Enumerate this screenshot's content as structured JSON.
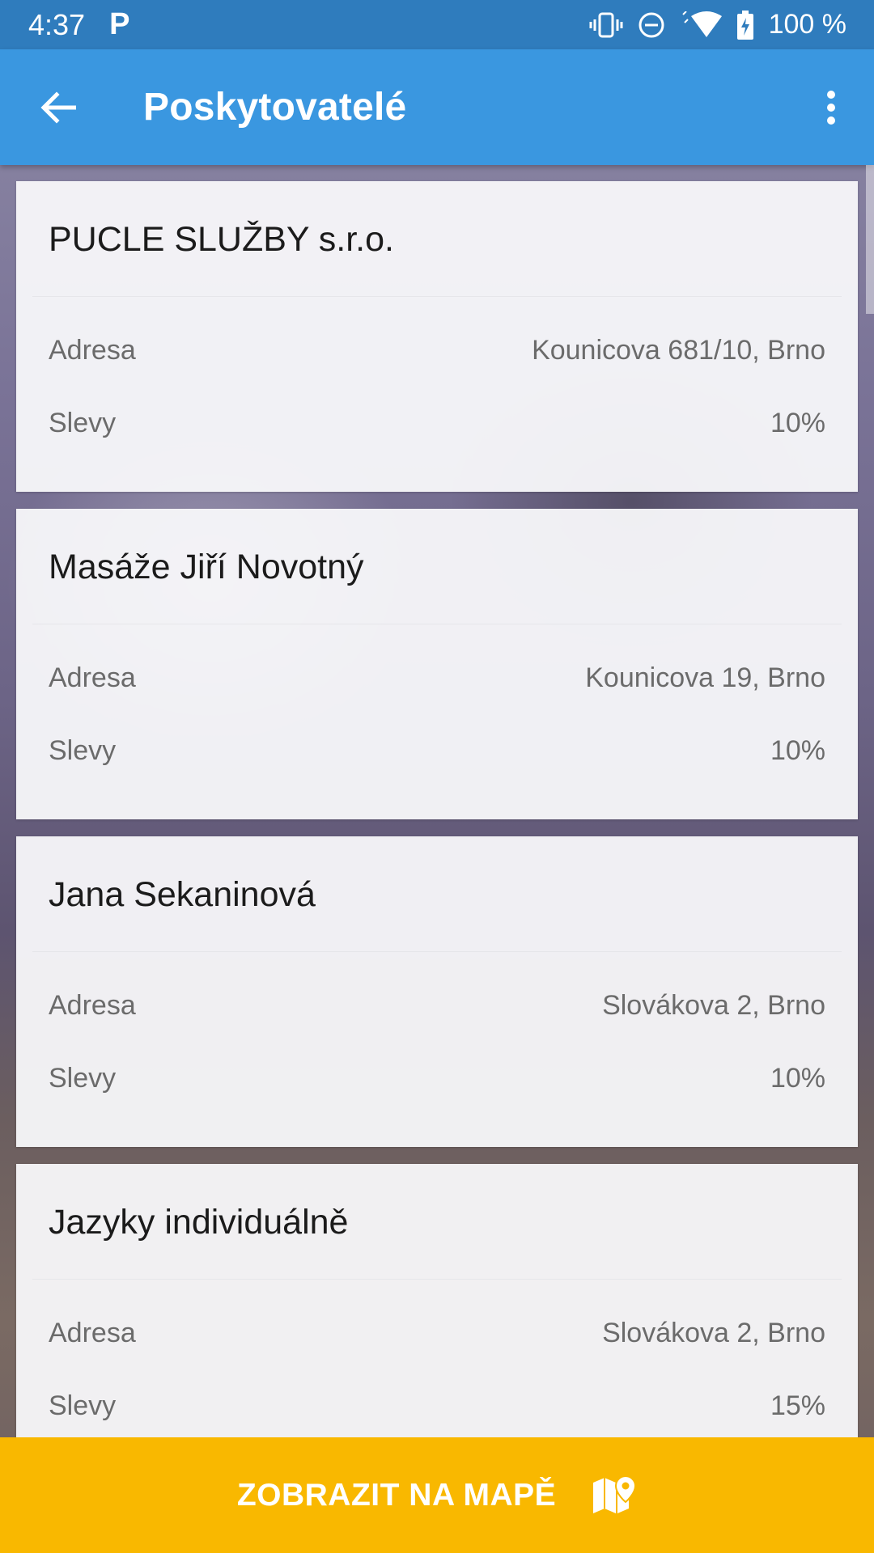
{
  "status_bar": {
    "time": "4:37",
    "notification": "P",
    "battery": "100 %",
    "icons": [
      "vibrate-icon",
      "do-not-disturb-icon",
      "wifi-icon",
      "battery-charging-icon"
    ]
  },
  "app_bar": {
    "title": "Poskytovatelé",
    "color": "#3a97e0"
  },
  "providers": [
    {
      "name": "PUCLE SLUŽBY s.r.o.",
      "address_label": "Adresa",
      "address": "Kounicova 681/10, Brno",
      "discount_label": "Slevy",
      "discount": "10%"
    },
    {
      "name": "Masáže Jiří Novotný",
      "address_label": "Adresa",
      "address": "Kounicova 19, Brno",
      "discount_label": "Slevy",
      "discount": "10%"
    },
    {
      "name": "Jana Sekaninová",
      "address_label": "Adresa",
      "address": "Slovákova 2, Brno",
      "discount_label": "Slevy",
      "discount": "10%"
    },
    {
      "name": "Jazyky individuálně",
      "address_label": "Adresa",
      "address": "Slovákova 2, Brno",
      "discount_label": "Slevy",
      "discount": "15%"
    }
  ],
  "map_button": {
    "label": "ZOBRAZIT NA MAPĚ",
    "color": "#f9b800",
    "icon": "map-marker-icon"
  }
}
